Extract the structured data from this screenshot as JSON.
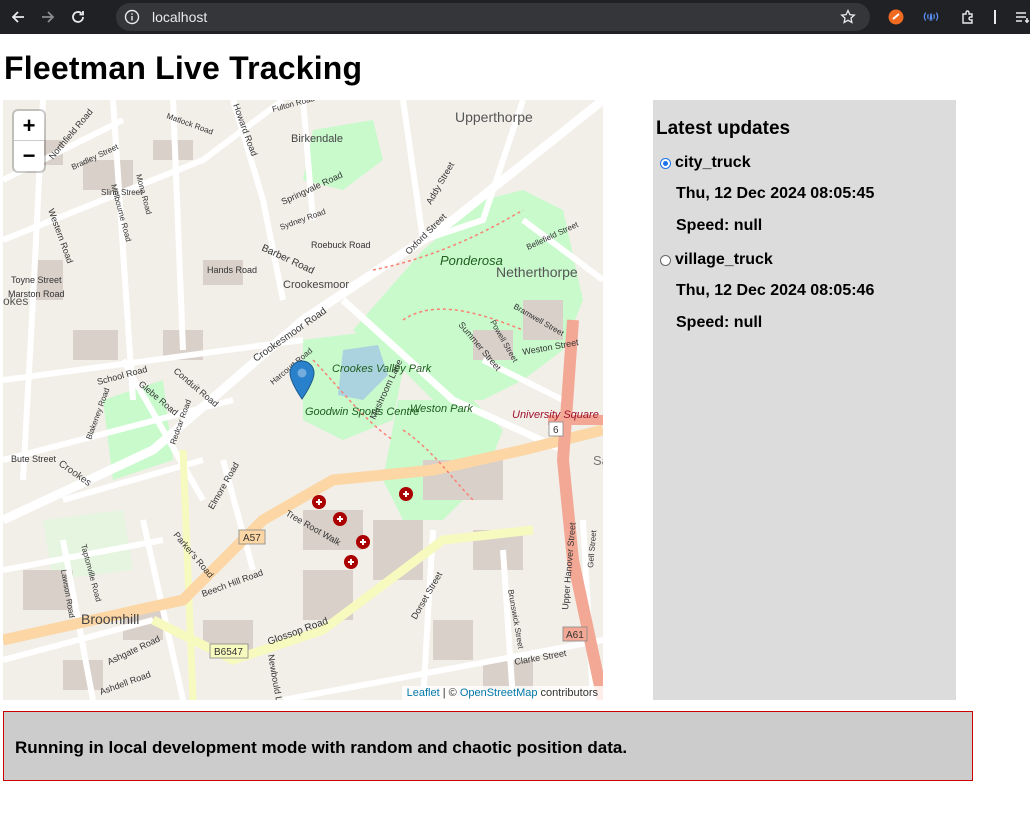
{
  "browser": {
    "url": "localhost"
  },
  "page": {
    "title": "Fleetman Live Tracking"
  },
  "map": {
    "zoom_in": "+",
    "zoom_out": "−",
    "attribution": {
      "leaflet": "Leaflet",
      "separator": " | © ",
      "osm": "OpenStreetMap",
      "suffix": " contributors"
    },
    "labels": {
      "upperthorpe": "Upperthorpe",
      "netherthorpe": "Netherthorpe",
      "ponderosa": "Ponderosa",
      "birkendale": "Birkendale",
      "crookesmoor": "Crookesmoor",
      "crookes_valley_park": "Crookes Valley Park",
      "goodwin_sports_centre": "Goodwin Sports Centre",
      "weston_park": "Weston Park",
      "university_square": "University Square",
      "broomhill": "Broomhill",
      "crookes": "Crookes",
      "a57": "A57",
      "b6547": "B6547",
      "a61": "A61",
      "six": "6",
      "upper_hanover_street": "Upper Hanover Street",
      "glossop_road": "Glossop Road",
      "crookesmoor_road": "Crookesmoor Road",
      "barber_road": "Barber Road",
      "school_road": "School Road",
      "northfield_road": "Northfield Road",
      "western_road": "Western Road",
      "mushroom_lane": "Mushroom Lane",
      "summer_street": "Summer Street",
      "weston_street": "Weston Street",
      "addy_street": "Addy Street",
      "oxford_street": "Oxford Street",
      "tree_root_walk": "Tree Root Walk",
      "ashgate_road": "Ashgate Road",
      "beech_hill_road": "Beech Hill Road",
      "dorset_street": "Dorset Street",
      "clarke_street": "Clarke Street",
      "harcourt_road": "Harcourt Road",
      "howard_road": "Howard Road",
      "matlock_road": "Matlock Road",
      "fulton_road": "Fulton Road",
      "springvale_road": "Springvale Road",
      "sydney_road": "Sydney Road",
      "roebuck_road": "Roebuck Road",
      "hands_road": "Hands Road",
      "glebe_road": "Glebe Road",
      "conduit_road": "Conduit Road",
      "bute_street": "Bute Street",
      "slinn_street": "Slinn Street",
      "bradley_street": "Bradley Street",
      "toyne_street": "Toyne Street",
      "marston_road": "Marston Road",
      "parkers_road": "Parker's Road",
      "elmore_road": "Elmore Road",
      "bellefield_street": "Bellefield Street",
      "bramwell_street": "Bramwell Street",
      "powell_street": "Powell Street",
      "brunswick_street": "Brunswick Street",
      "gell_street": "Gell Street",
      "ashdell_road": "Ashdell Road",
      "newbould_lane": "Newbould Lane",
      "taptonville_road": "Taptonville Road",
      "lawson_road": "Lawson Road",
      "blakeney_road": "Blakeney Road",
      "redcar_road": "Redcar Road",
      "mona_road": "Mona Road",
      "melbourne_road": "Melbourne Road",
      "sa": "Sa",
      "okes": "okes"
    }
  },
  "updates": {
    "heading": "Latest updates",
    "trucks": [
      {
        "name": "city_truck",
        "time": "Thu, 12 Dec 2024 08:05:45",
        "speed": "Speed: null",
        "selected": true
      },
      {
        "name": "village_truck",
        "time": "Thu, 12 Dec 2024 08:05:46",
        "speed": "Speed: null",
        "selected": false
      }
    ]
  },
  "banner": {
    "text": "Running in local development mode with random and chaotic position data."
  },
  "colors": {
    "chrome": "#202124",
    "map_bg": "#f2efe9",
    "panel_bg": "#dcdcdc",
    "banner_border": "#cc0000",
    "marker": "#2a81cb",
    "park": "#c8facc",
    "water": "#aad3df",
    "primary_road": "#fcd6a4",
    "secondary_road": "#f7fabf",
    "trunk_road": "#f3a896"
  },
  "icons": [
    "back-arrow-icon",
    "forward-arrow-icon",
    "reload-icon",
    "info-icon",
    "star-icon",
    "map-marker-icon",
    "hospital-icon",
    "extension-icon"
  ]
}
